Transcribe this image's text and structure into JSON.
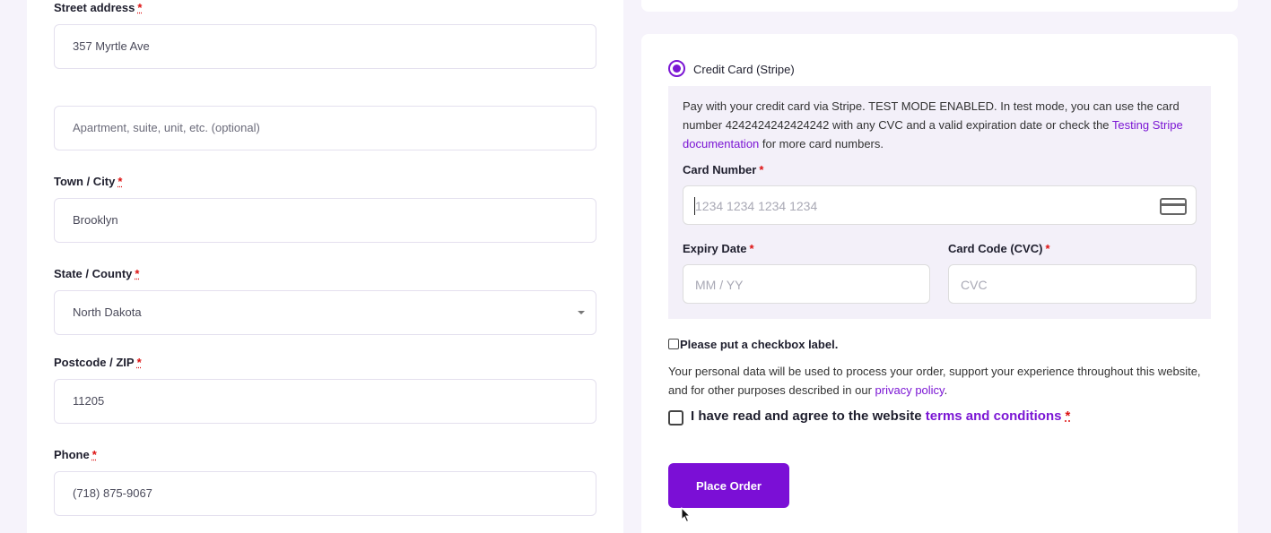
{
  "billing": {
    "street_label": "Street address",
    "street_value": "357 Myrtle Ave",
    "street2_placeholder": "Apartment, suite, unit, etc. (optional)",
    "city_label": "Town / City",
    "city_value": "Brooklyn",
    "state_label": "State / County",
    "state_value": "North Dakota",
    "zip_label": "Postcode / ZIP",
    "zip_value": "11205",
    "phone_label": "Phone",
    "phone_value": "(718) 875-9067",
    "required_mark": "*"
  },
  "payment": {
    "method_label": "Credit Card (Stripe)",
    "description_part1": "Pay with your credit card via Stripe. TEST MODE ENABLED. In test mode, you can use the card number 4242424242424242 with any CVC and a valid expiration date or check the ",
    "description_link": "Testing Stripe documentation",
    "description_part2": " for more card numbers.",
    "card_number_label": "Card Number",
    "card_number_placeholder": "1234 1234 1234 1234",
    "expiry_label": "Expiry Date",
    "expiry_placeholder": "MM / YY",
    "cvc_label": "Card Code (CVC)",
    "cvc_placeholder": "CVC",
    "required_mark": "*"
  },
  "checkout": {
    "checkbox_label": "Please put a checkbox label.",
    "privacy_part1": "Your personal data will be used to process your order, support your experience throughout this website, and for other purposes described in our ",
    "privacy_link": "privacy policy",
    "privacy_part2": ".",
    "terms_part1": "I have read and agree to the website ",
    "terms_link": "terms and conditions",
    "terms_required": "*",
    "place_order_label": "Place Order"
  },
  "colors": {
    "accent": "#7b0fd6",
    "page_background": "#f6f3fb",
    "stripe_box_background": "#f3f0f9"
  }
}
